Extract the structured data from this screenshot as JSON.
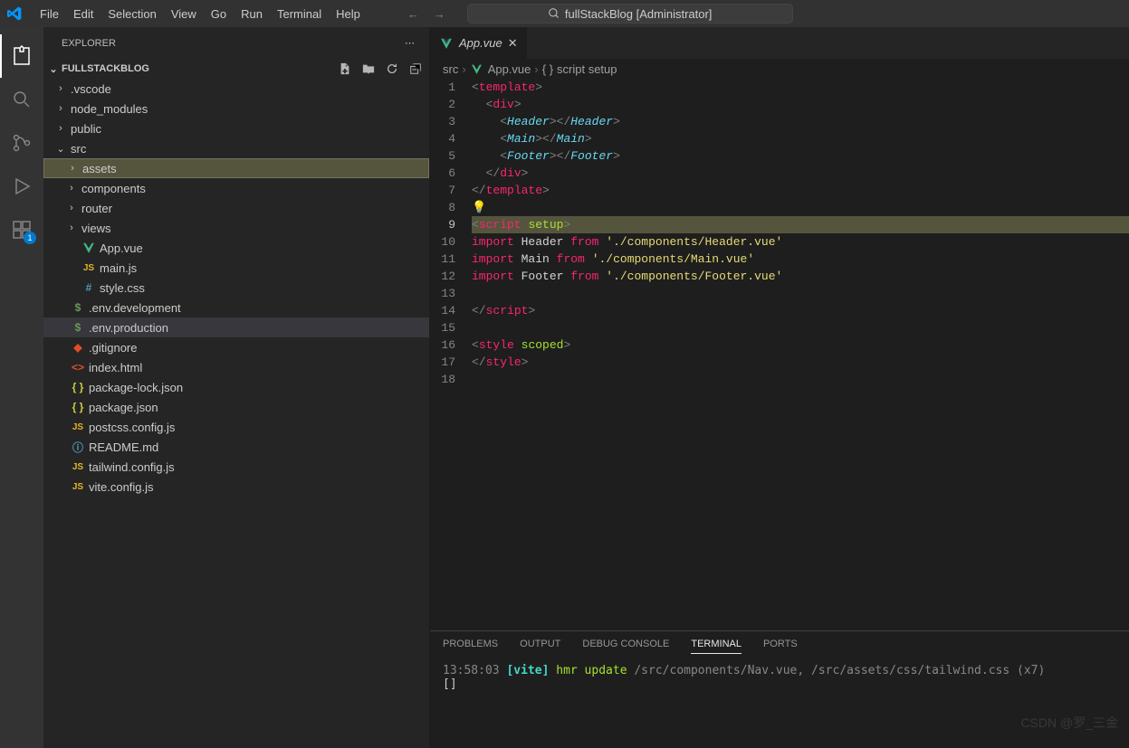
{
  "titlebar": {
    "menus": [
      "File",
      "Edit",
      "Selection",
      "View",
      "Go",
      "Run",
      "Terminal",
      "Help"
    ],
    "search_text": "fullStackBlog [Administrator]"
  },
  "activity": {
    "extensions_badge": "1"
  },
  "sidebar": {
    "title": "EXPLORER",
    "project": "FULLSTACKBLOG",
    "tree": [
      {
        "label": ".vscode",
        "type": "folder",
        "depth": 1,
        "expanded": false
      },
      {
        "label": "node_modules",
        "type": "folder",
        "depth": 1,
        "expanded": false
      },
      {
        "label": "public",
        "type": "folder",
        "depth": 1,
        "expanded": false
      },
      {
        "label": "src",
        "type": "folder",
        "depth": 1,
        "expanded": true
      },
      {
        "label": "assets",
        "type": "folder",
        "depth": 2,
        "expanded": false,
        "selected": true
      },
      {
        "label": "components",
        "type": "folder",
        "depth": 2,
        "expanded": false
      },
      {
        "label": "router",
        "type": "folder",
        "depth": 2,
        "expanded": false
      },
      {
        "label": "views",
        "type": "folder",
        "depth": 2,
        "expanded": false
      },
      {
        "label": "App.vue",
        "type": "vue",
        "depth": 2
      },
      {
        "label": "main.js",
        "type": "js",
        "depth": 2
      },
      {
        "label": "style.css",
        "type": "css",
        "depth": 2
      },
      {
        "label": ".env.development",
        "type": "env",
        "depth": 1
      },
      {
        "label": ".env.production",
        "type": "env",
        "depth": 1,
        "highlighted": true
      },
      {
        "label": ".gitignore",
        "type": "git",
        "depth": 1
      },
      {
        "label": "index.html",
        "type": "html",
        "depth": 1
      },
      {
        "label": "package-lock.json",
        "type": "json",
        "depth": 1
      },
      {
        "label": "package.json",
        "type": "json",
        "depth": 1
      },
      {
        "label": "postcss.config.js",
        "type": "js",
        "depth": 1
      },
      {
        "label": "README.md",
        "type": "md",
        "depth": 1
      },
      {
        "label": "tailwind.config.js",
        "type": "js",
        "depth": 1
      },
      {
        "label": "vite.config.js",
        "type": "js",
        "depth": 1
      }
    ]
  },
  "tabs": {
    "open": [
      {
        "label": "App.vue",
        "icon": "vue",
        "active": true
      }
    ]
  },
  "breadcrumb": {
    "parts": [
      "src",
      "App.vue",
      "script setup"
    ]
  },
  "editor": {
    "current_line": 9,
    "lines": [
      {
        "n": 1,
        "html": "<span class='p'>&lt;</span><span class='tag'>template</span><span class='p'>&gt;</span>"
      },
      {
        "n": 2,
        "html": "  <span class='p'>&lt;</span><span class='tag'>div</span><span class='p'>&gt;</span>"
      },
      {
        "n": 3,
        "html": "    <span class='p'>&lt;</span><span class='comp'>Header</span><span class='p'>&gt;&lt;/</span><span class='comp'>Header</span><span class='p'>&gt;</span>"
      },
      {
        "n": 4,
        "html": "    <span class='p'>&lt;</span><span class='comp'>Main</span><span class='p'>&gt;&lt;/</span><span class='comp'>Main</span><span class='p'>&gt;</span>"
      },
      {
        "n": 5,
        "html": "    <span class='p'>&lt;</span><span class='comp'>Footer</span><span class='p'>&gt;&lt;/</span><span class='comp'>Footer</span><span class='p'>&gt;</span>"
      },
      {
        "n": 6,
        "html": "  <span class='p'>&lt;/</span><span class='tag'>div</span><span class='p'>&gt;</span>"
      },
      {
        "n": 7,
        "html": "<span class='p'>&lt;/</span><span class='tag'>template</span><span class='p'>&gt;</span>"
      },
      {
        "n": 8,
        "html": "<span class='bulb'>💡</span>"
      },
      {
        "n": 9,
        "html": "<span class='p'>&lt;</span><span class='tag'>script</span> <span class='attr'>setup</span><span class='p'>&gt;</span>",
        "hl": true
      },
      {
        "n": 10,
        "html": "<span class='kw'>import</span> <span class='ident'>Header</span> <span class='kw'>from</span> <span class='str'>'./components/Header.vue'</span>"
      },
      {
        "n": 11,
        "html": "<span class='kw'>import</span> <span class='ident'>Main</span> <span class='kw'>from</span> <span class='str'>'./components/Main.vue'</span>"
      },
      {
        "n": 12,
        "html": "<span class='kw'>import</span> <span class='ident'>Footer</span> <span class='kw'>from</span> <span class='str'>'./components/Footer.vue'</span>"
      },
      {
        "n": 13,
        "html": ""
      },
      {
        "n": 14,
        "html": "<span class='p'>&lt;/</span><span class='tag'>script</span><span class='p'>&gt;</span>"
      },
      {
        "n": 15,
        "html": ""
      },
      {
        "n": 16,
        "html": "<span class='p'>&lt;</span><span class='tag'>style</span> <span class='attr'>scoped</span><span class='p'>&gt;</span>"
      },
      {
        "n": 17,
        "html": "<span class='p'>&lt;/</span><span class='tag'>style</span><span class='p'>&gt;</span>"
      },
      {
        "n": 18,
        "html": ""
      }
    ]
  },
  "panel": {
    "tabs": [
      "PROBLEMS",
      "OUTPUT",
      "DEBUG CONSOLE",
      "TERMINAL",
      "PORTS"
    ],
    "active": "TERMINAL",
    "terminal": {
      "time": "13:58:03",
      "tag": "[vite]",
      "action": "hmr update",
      "paths": "/src/components/Nav.vue, /src/assets/css/tailwind.css",
      "count": "(x7)",
      "cursor": "[]"
    }
  },
  "watermark": "CSDN @罗_三金"
}
